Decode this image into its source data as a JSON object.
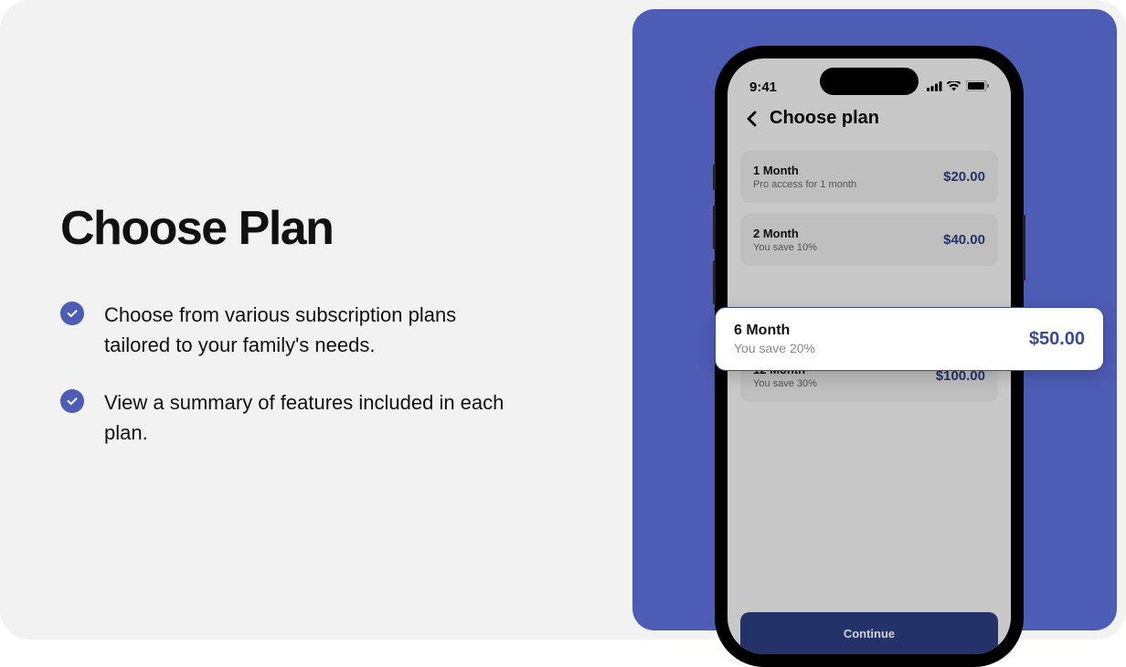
{
  "left": {
    "heading": "Choose Plan",
    "bullets": [
      "Choose from various subscription plans tailored to your family's needs.",
      "View a summary of features included in each plan."
    ]
  },
  "phone": {
    "time": "9:41",
    "screen_title": "Choose plan",
    "plans": [
      {
        "name": "1 Month",
        "desc": "Pro access for 1 month",
        "price": "$20.00",
        "selected": false
      },
      {
        "name": "2 Month",
        "desc": "You save 10%",
        "price": "$40.00",
        "selected": false
      },
      {
        "name": "6 Month",
        "desc": "You save 20%",
        "price": "$50.00",
        "selected": true
      },
      {
        "name": "12 Month",
        "desc": "You save 30%",
        "price": "$100.00",
        "selected": false
      }
    ],
    "continue_label": "Continue"
  },
  "colors": {
    "accent": "#4d5db6",
    "price": "#2d3d82"
  }
}
